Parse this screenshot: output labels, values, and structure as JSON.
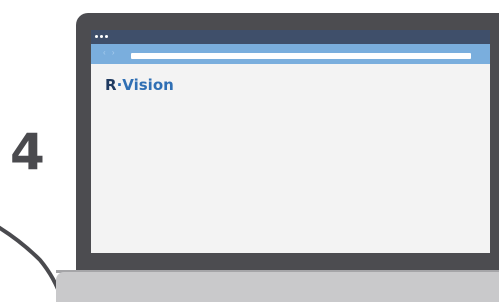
{
  "step": {
    "number": "4"
  },
  "browser": {
    "nav_arrows": "‹ ›",
    "logo_r": "R",
    "logo_rest": "·Vision"
  }
}
